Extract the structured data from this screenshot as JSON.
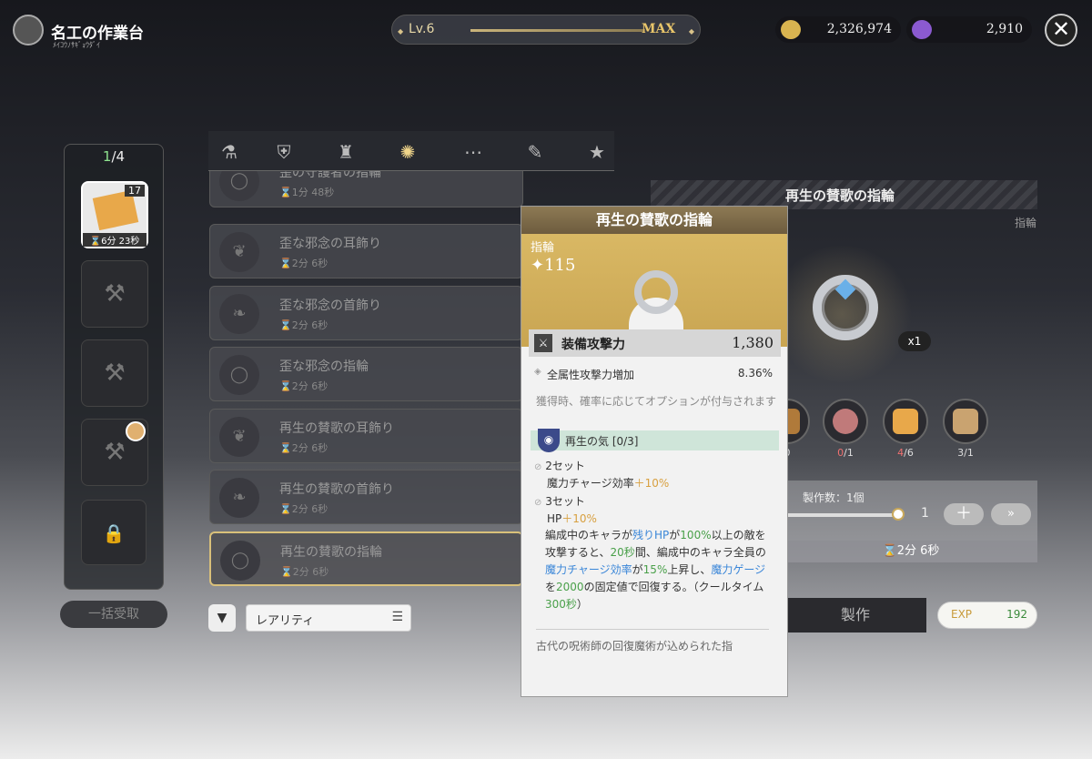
{
  "header": {
    "title": "名工の作業台",
    "subtitle": "ﾒｲｺｳﾉｻｷﾞｮｳﾀﾞｲ",
    "level_label": "Lv.6",
    "level_max": "MAX",
    "gold": "2,326,974",
    "gems": "2,910",
    "close_icon": "close-icon"
  },
  "queue": {
    "count_current": "1",
    "count_total": "/4",
    "active_slot": {
      "badge": "17",
      "time": "⌛6分 23秒"
    },
    "bulk_receive_label": "一括受取"
  },
  "tabs": [
    "potion-icon",
    "shield-icon",
    "armor-icon",
    "accessory-icon",
    "more-icon",
    "bandage-icon",
    "star-icon"
  ],
  "list": {
    "items": [
      {
        "name": "歪の守護者の指輪",
        "time": "⌛1分 48秒"
      },
      {
        "name": "歪な邪念の耳飾り",
        "time": "⌛2分 6秒"
      },
      {
        "name": "歪な邪念の首飾り",
        "time": "⌛2分 6秒"
      },
      {
        "name": "歪な邪念の指輪",
        "time": "⌛2分 6秒"
      },
      {
        "name": "再生の賛歌の耳飾り",
        "time": "⌛2分 6秒"
      },
      {
        "name": "再生の賛歌の首飾り",
        "time": "⌛2分 6秒"
      },
      {
        "name": "再生の賛歌の指輪",
        "time": "⌛2分 6秒"
      }
    ]
  },
  "filter": {
    "sort_label": "レアリティ"
  },
  "detail": {
    "title": "再生の賛歌の指輪",
    "category": "指輪",
    "quantity_badge": "x1",
    "materials": [
      {
        "have": "",
        "need": "0"
      },
      {
        "have": "0",
        "need": "/1"
      },
      {
        "have": "4",
        "need": "/6"
      },
      {
        "have": "3",
        "need": "/1"
      }
    ],
    "craft_count_label": "製作数：1個",
    "quantity": "1",
    "plus_label": "＋",
    "ff_label": "»",
    "craft_time": "⌛2分 6秒",
    "craft_button": "製作",
    "exp_label": "EXP",
    "exp_value": "192"
  },
  "tooltip": {
    "title": "再生の賛歌の指輪",
    "category": "指輪",
    "power": "✦115",
    "main_stat_name": "装備攻撃力",
    "main_stat_value": "1,380",
    "sub_stat_name": "全属性攻撃力増加",
    "sub_stat_value": "8.36%",
    "note": "獲得時、確率に応じてオプションが付与されます",
    "set_name": "再生の気 [0/3]",
    "set2_label": "2セット",
    "set2_effect": "魔力チャージ効率",
    "set2_value": "＋10%",
    "set3_label": "3セット",
    "set3_hp": "HP",
    "set3_hp_value": "＋10%",
    "desc": {
      "p1": "編成中のキャラが",
      "b1": "残りHP",
      "p2": "が",
      "g1": "100%",
      "p3": "以上の敵を攻撃すると、",
      "g2": "20秒",
      "p4": "間、編成中のキャラ全員の",
      "b2": "魔力チャージ効率",
      "p5": "が",
      "g3": "15%",
      "p6": "上昇し、",
      "b3": "魔力ゲージ",
      "p7": "を",
      "g4": "2000",
      "p8": "の固定値で回復する。（クールタイム",
      "g5": "300秒",
      "p9": "）"
    },
    "lore": "古代の呪術師の回復魔術が込められた指"
  }
}
